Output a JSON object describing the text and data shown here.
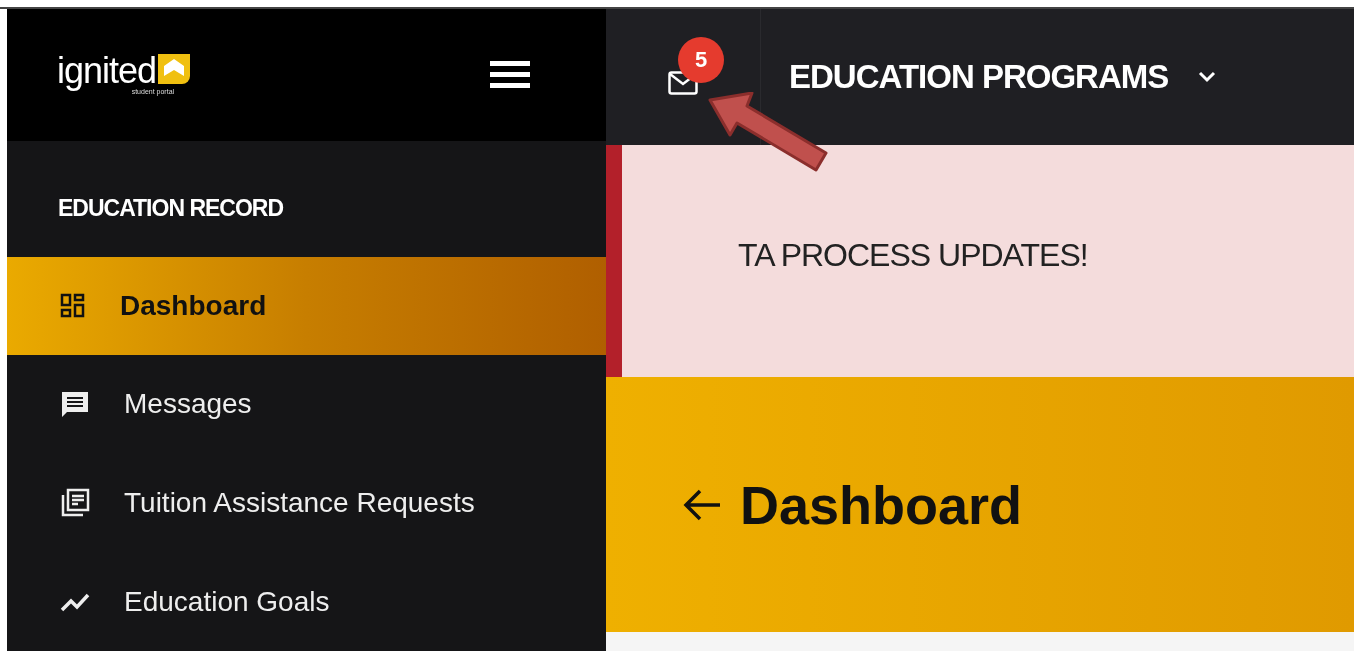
{
  "logo": {
    "name": "ignited",
    "tagline": "student portal"
  },
  "topbar": {
    "notification_count": "5",
    "program_menu": {
      "label": "EDUCATION PROGRAMS",
      "expanded": false
    }
  },
  "sidebar": {
    "section_title": "EDUCATION RECORD",
    "items": [
      {
        "label": "Dashboard",
        "kind": "dashboard",
        "selected": true
      },
      {
        "label": "Messages",
        "kind": "messages",
        "selected": false
      },
      {
        "label": "Tuition Assistance Requests",
        "kind": "requests",
        "selected": false
      },
      {
        "label": "Education Goals",
        "kind": "goals",
        "selected": false
      }
    ]
  },
  "alert": {
    "text": "TA PROCESS UPDATES!"
  },
  "page_header": {
    "title": "Dashboard"
  }
}
